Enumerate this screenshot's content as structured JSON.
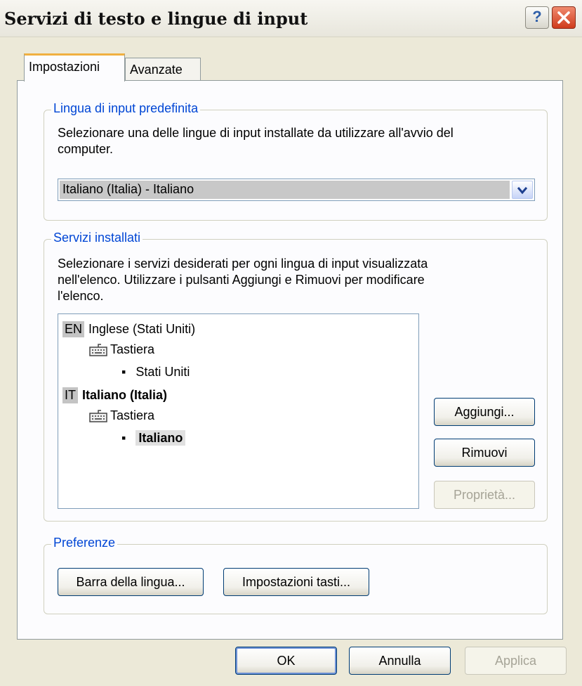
{
  "window": {
    "title": "Servizi di testo e lingue di input",
    "help_label": "?"
  },
  "tabs": [
    {
      "label": "Impostazioni",
      "active": true
    },
    {
      "label": "Avanzate",
      "active": false
    }
  ],
  "default_language": {
    "legend": "Lingua di input predefinita",
    "description_line1": "Selezionare una delle lingue di input installate da utilizzare all'avvio del",
    "description_line2": "computer.",
    "selected": "Italiano (Italia) - Italiano"
  },
  "installed_services": {
    "legend": "Servizi installati",
    "description_line1": "Selezionare i servizi desiderati per ogni lingua di input visualizzata",
    "description_line2": "nell'elenco. Utilizzare i pulsanti Aggiungi e Rimuovi per modificare",
    "description_line3": "l'elenco.",
    "languages": [
      {
        "code": "EN",
        "name": "Inglese (Stati Uniti)",
        "category": "Tastiera",
        "layout": "Stati Uniti"
      },
      {
        "code": "IT",
        "name": "Italiano (Italia)",
        "category": "Tastiera",
        "layout": "Italiano"
      }
    ],
    "add_label": "Aggiungi...",
    "remove_label": "Rimuovi",
    "properties_label": "Proprietà..."
  },
  "preferences": {
    "legend": "Preferenze",
    "language_bar_label": "Barra della lingua...",
    "key_settings_label": "Impostazioni tasti..."
  },
  "footer": {
    "ok_label": "OK",
    "cancel_label": "Annulla",
    "apply_label": "Applica"
  }
}
